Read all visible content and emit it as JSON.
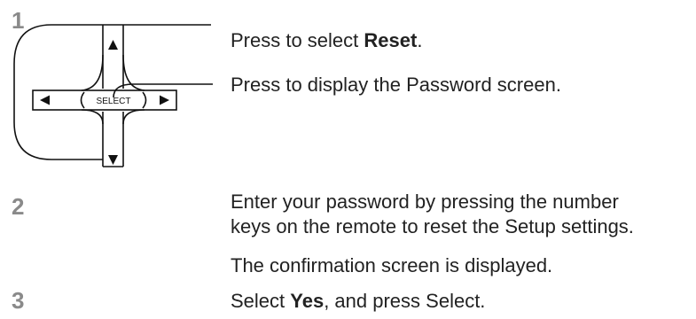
{
  "steps": [
    {
      "number": "1",
      "lines": [
        {
          "prefix": "Press to select ",
          "bold": "Reset",
          "suffix": "."
        },
        {
          "text": "Press to display the Password screen."
        }
      ]
    },
    {
      "number": "2",
      "lines": [
        {
          "text": "Enter your password by pressing the number"
        },
        {
          "text": "keys on the remote to reset the Setup settings."
        },
        {
          "text": "The confirmation screen is displayed."
        }
      ]
    },
    {
      "number": "3",
      "lines": [
        {
          "prefix": "Select ",
          "bold": "Yes",
          "suffix": ", and press Select."
        }
      ]
    }
  ],
  "remote_diagram": {
    "select_label": "SELECT",
    "icons": [
      "arrow-up-icon",
      "arrow-down-icon",
      "arrow-left-icon",
      "arrow-right-icon"
    ]
  },
  "colors": {
    "step_number": "#8a8a8a",
    "text": "#222222",
    "line": "#111111"
  }
}
